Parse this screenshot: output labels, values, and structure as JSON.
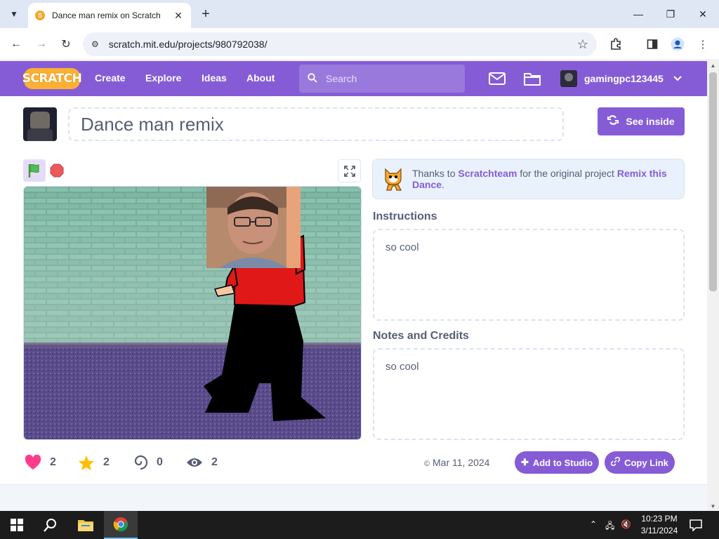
{
  "browser": {
    "tab_title": "Dance man remix on Scratch",
    "url": "scratch.mit.edu/projects/980792038/"
  },
  "navbar": {
    "logo_text": "SCRATCH",
    "links": [
      "Create",
      "Explore",
      "Ideas",
      "About"
    ],
    "search_placeholder": "Search",
    "username": "gamingpc123445"
  },
  "project": {
    "title": "Dance man remix",
    "see_inside_label": "See inside",
    "thanks": {
      "prefix": "Thanks to",
      "author": "Scratchteam",
      "middle": "for the original project",
      "original": "Remix this Dance",
      "suffix": "."
    },
    "instructions_label": "Instructions",
    "instructions": "so cool",
    "notes_label": "Notes and Credits",
    "notes": "so cool",
    "stats": {
      "loves": "2",
      "favorites": "2",
      "remixes": "0",
      "views": "2"
    },
    "date": "Mar 11, 2024",
    "add_to_studio_label": "Add to Studio",
    "copy_link_label": "Copy Link"
  },
  "taskbar": {
    "time": "10:23 PM",
    "date": "3/11/2024"
  },
  "colors": {
    "scratch_purple": "#855cd6",
    "scratch_orange": "#fbb034",
    "love_pink": "#ff3b8c",
    "star_yellow": "#ffbf00"
  }
}
